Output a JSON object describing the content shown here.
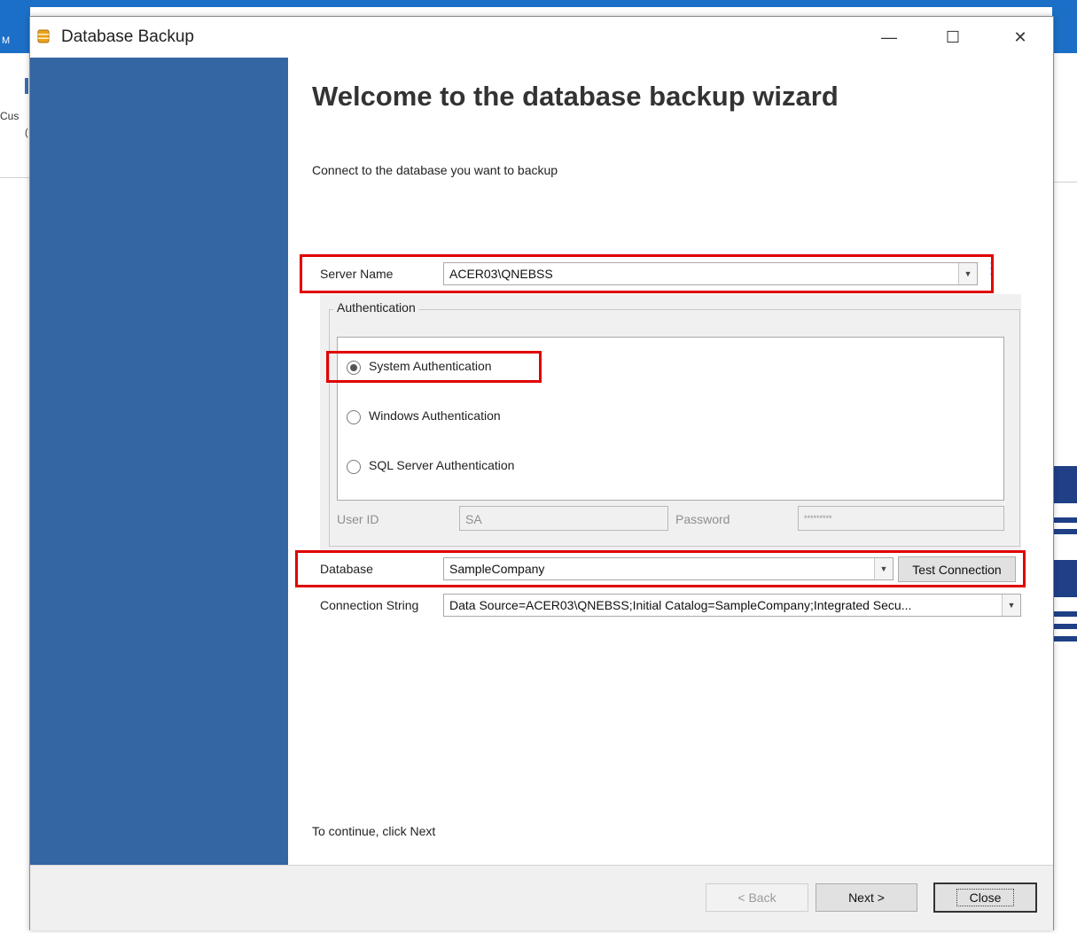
{
  "background_app": {
    "title_fragment": "M",
    "side_label": "Cus",
    "side_label_2": "("
  },
  "window": {
    "title": "Database Backup",
    "icon": "database-icon",
    "controls": {
      "minimize": "—",
      "maximize": "☐",
      "close": "✕"
    }
  },
  "wizard": {
    "heading": "Welcome to the database backup wizard",
    "subtext": "Connect to the database you want to backup",
    "footer": "To continue, click Next"
  },
  "server": {
    "label": "Server Name",
    "value": "ACER03\\QNEBSS",
    "dropdown_icon": "▼",
    "more_icon": "⋮"
  },
  "authentication": {
    "group_title": "Authentication",
    "options": [
      {
        "label": "System Authentication",
        "checked": true
      },
      {
        "label": "Windows Authentication",
        "checked": false
      },
      {
        "label": "SQL Server Authentication",
        "checked": false
      }
    ],
    "user_id_label": "User ID",
    "user_id_value": "SA",
    "password_label": "Password",
    "password_value": "*********"
  },
  "database": {
    "label": "Database",
    "value": "SampleCompany",
    "dropdown_icon": "▼",
    "test_button": "Test Connection"
  },
  "connection_string": {
    "label": "Connection String",
    "value": "Data Source=ACER03\\QNEBSS;Initial Catalog=SampleCompany;Integrated Secu...",
    "dropdown_icon": "▼"
  },
  "buttons": {
    "back": "< Back",
    "next": "Next >",
    "close": "Close"
  },
  "colors": {
    "sidebar": "#3366a3",
    "highlight": "#e00000",
    "background_titlebar": "#1b6fc6"
  }
}
